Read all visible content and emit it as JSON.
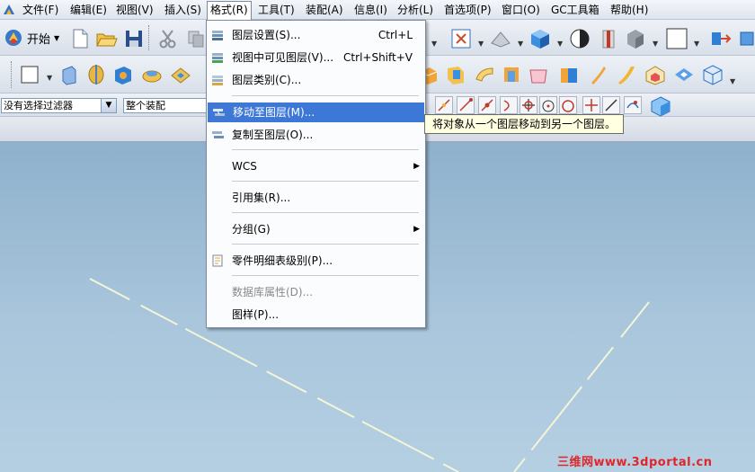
{
  "menubar": {
    "items": [
      {
        "label": "文件(F)"
      },
      {
        "label": "编辑(E)"
      },
      {
        "label": "视图(V)"
      },
      {
        "label": "插入(S)"
      },
      {
        "label": "格式(R)"
      },
      {
        "label": "工具(T)"
      },
      {
        "label": "装配(A)"
      },
      {
        "label": "信息(I)"
      },
      {
        "label": "分析(L)"
      },
      {
        "label": "首选项(P)"
      },
      {
        "label": "窗口(O)"
      },
      {
        "label": "GC工具箱"
      },
      {
        "label": "帮助(H)"
      }
    ]
  },
  "toolbar": {
    "start_label": "开始",
    "filter_combo": "没有选择过滤器",
    "assembly_combo": "整个装配"
  },
  "format_menu": {
    "items": [
      {
        "label": "图层设置(S)...",
        "shortcut": "Ctrl+L",
        "icon": "layer-settings-icon"
      },
      {
        "label": "视图中可见图层(V)...",
        "shortcut": "Ctrl+Shift+V",
        "icon": "visible-layers-icon"
      },
      {
        "label": "图层类别(C)...",
        "icon": "layer-category-icon"
      },
      {
        "label": "移动至图层(M)...",
        "icon": "move-to-layer-icon",
        "highlighted": true
      },
      {
        "label": "复制至图层(O)...",
        "icon": "copy-to-layer-icon"
      },
      {
        "label": "WCS",
        "submenu": true
      },
      {
        "label": "引用集(R)..."
      },
      {
        "label": "分组(G)",
        "submenu": true
      },
      {
        "label": "零件明细表级别(P)...",
        "icon": "parts-list-icon"
      },
      {
        "label": "数据库属性(D)...",
        "disabled": true
      },
      {
        "label": "图样(P)..."
      }
    ]
  },
  "tooltip": "将对象从一个图层移动到另一个图层。",
  "watermark": "三维网www.3dportal.cn",
  "colors": {
    "menu_highlight": "#3d78d6",
    "canvas_top": "#8fb1cc",
    "canvas_bottom": "#b5cfe2",
    "wcs_lines": "#f4f4d6",
    "watermark": "#e0262a"
  }
}
